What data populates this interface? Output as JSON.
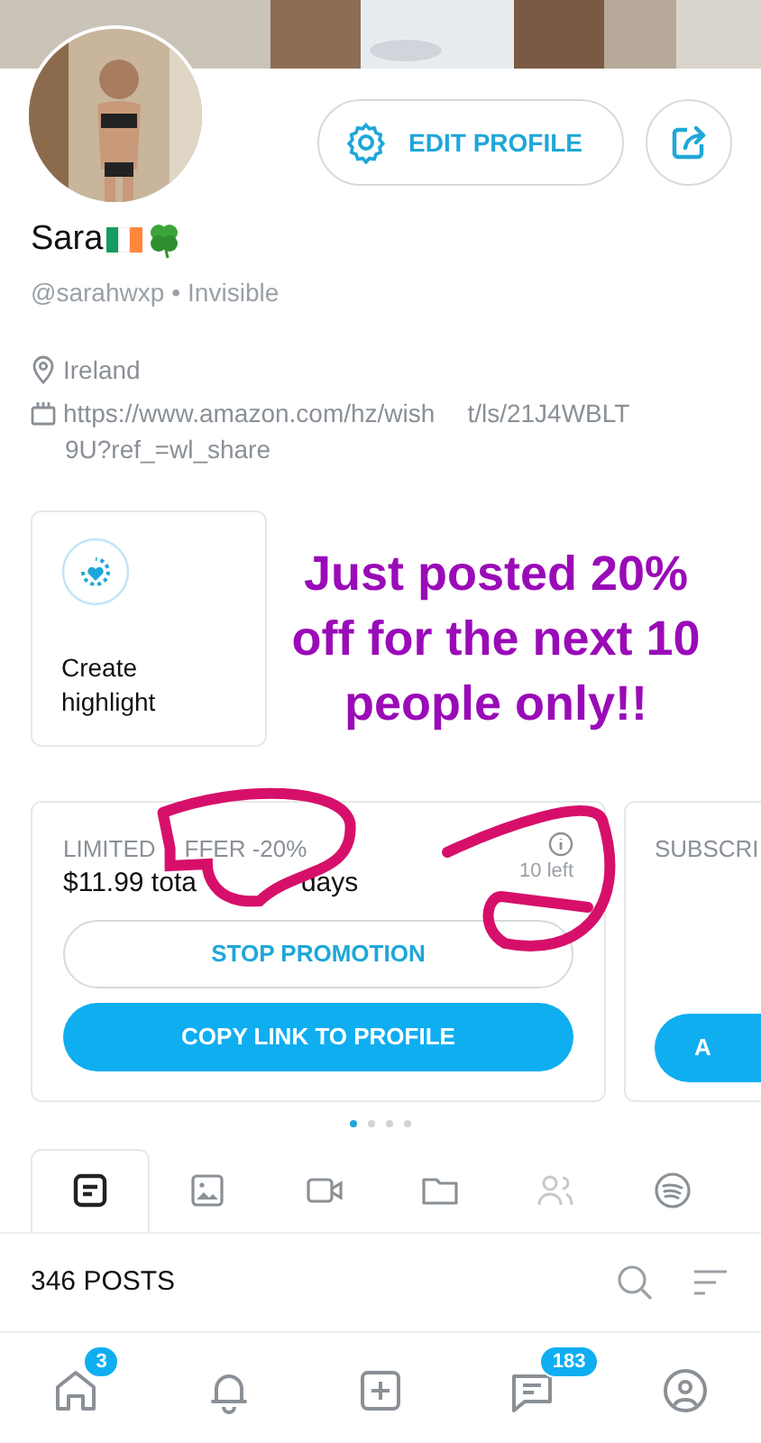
{
  "edit_button": {
    "label": "EDIT PROFILE"
  },
  "profile": {
    "name": "Sara",
    "handle": "@sarahwxp",
    "separator": "•",
    "status": "Invisible",
    "location": "Ireland",
    "link_parts": [
      "https://www.amazon.com/hz/wish",
      "t/ls/21J4WBLT"
    ],
    "link_line_2": "9U?ref_=wl_share"
  },
  "highlight": {
    "label": "Create highlight"
  },
  "annotation": {
    "text": "Just posted 20% off for the next 10 people only!!"
  },
  "offer_card": {
    "title_parts": [
      "LIMITED",
      "FFER -20%"
    ],
    "price_parts": [
      "$11.99 tota",
      "days"
    ],
    "remaining": "10 left",
    "buttons": [
      "STOP PROMOTION",
      "COPY LINK TO PROFILE"
    ]
  },
  "next_card": {
    "title": "SUBSCRI",
    "button": "A"
  },
  "carousel_dots": [
    {
      "selected": true
    },
    {
      "selected": false
    },
    {
      "selected": false
    },
    {
      "selected": false
    }
  ],
  "tabs": [
    {
      "kind": "posts",
      "selected": true
    },
    {
      "kind": "photos",
      "selected": false
    },
    {
      "kind": "videos",
      "selected": false
    },
    {
      "kind": "folders",
      "selected": false
    },
    {
      "kind": "people",
      "selected": false
    },
    {
      "kind": "music",
      "selected": false
    }
  ],
  "posts_count": "346 POSTS",
  "bottom_nav": [
    {
      "kind": "home",
      "badge": "3"
    },
    {
      "kind": "bell"
    },
    {
      "kind": "add"
    },
    {
      "kind": "chat",
      "badge": "183"
    },
    {
      "kind": "profile"
    }
  ]
}
